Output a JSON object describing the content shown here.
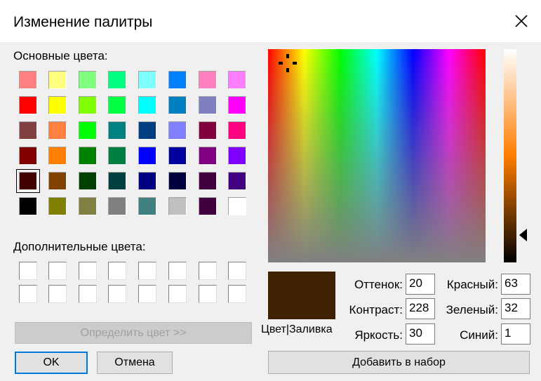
{
  "title": "Изменение палитры",
  "basic_colors_label": "Основные цвета:",
  "custom_colors_label": "Дополнительные цвета:",
  "basic_colors": [
    "#ff8080",
    "#ffff80",
    "#80ff80",
    "#00ff80",
    "#80ffff",
    "#0080ff",
    "#ff80c0",
    "#ff80ff",
    "#ff0000",
    "#ffff00",
    "#80ff00",
    "#00ff40",
    "#00ffff",
    "#0080c0",
    "#8080c0",
    "#ff00ff",
    "#804040",
    "#ff8040",
    "#00ff00",
    "#008080",
    "#004080",
    "#8080ff",
    "#800040",
    "#ff0080",
    "#800000",
    "#ff8000",
    "#008000",
    "#008040",
    "#0000ff",
    "#0000a0",
    "#800080",
    "#8000ff",
    "#400000",
    "#804000",
    "#004000",
    "#004040",
    "#000080",
    "#000040",
    "#400040",
    "#400080",
    "#000000",
    "#808000",
    "#808040",
    "#808080",
    "#408080",
    "#c0c0c0",
    "#400040",
    "#ffffff"
  ],
  "selected_basic_index": 32,
  "define_button": "Определить цвет >>",
  "ok_button": "OK",
  "cancel_button": "Отмена",
  "add_button": "Добавить в набор",
  "preview_label": "Цвет|Заливка",
  "preview_color": "#3f2001",
  "hue_label": "Оттенок:",
  "hue_value": "20",
  "sat_label": "Контраст:",
  "sat_value": "228",
  "lum_label": "Яркость:",
  "lum_value": "30",
  "red_label": "Красный:",
  "red_value": "63",
  "green_label": "Зеленый:",
  "green_value": "32",
  "blue_label": "Синий:",
  "blue_value": "1"
}
